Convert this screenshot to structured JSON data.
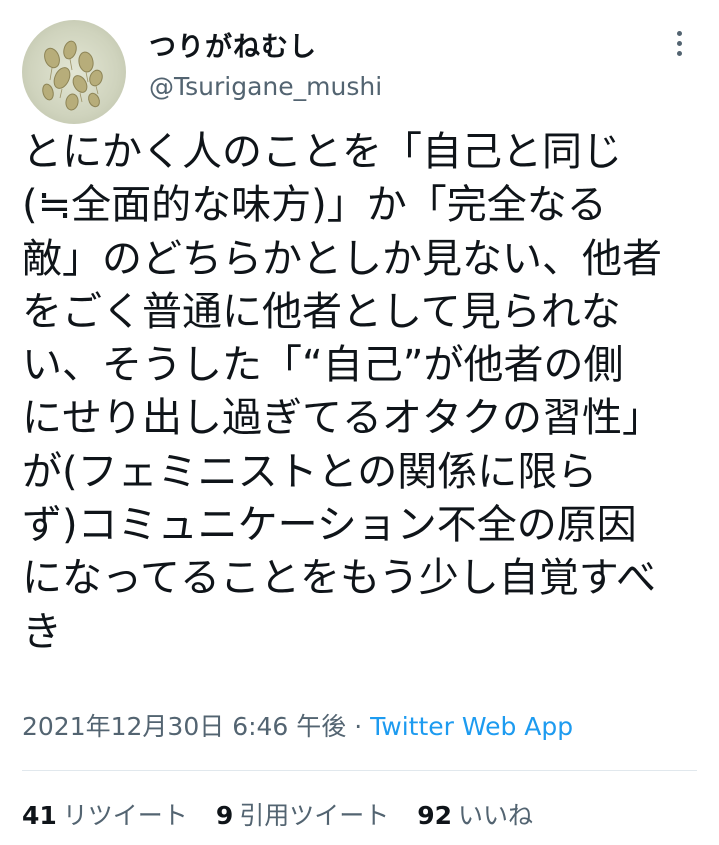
{
  "author": {
    "display_name": "つりがねむし",
    "handle": "@Tsurigane_mushi"
  },
  "tweet": {
    "lines": [
      "とにかく人のことを「自己と同じ",
      "(≒全面的な味方)」か「完全なる",
      "敵」のどちらかとしか見ない、他者",
      "をごく普通に他者として見られな",
      "い、そうした「“自己”が他者の側",
      "にせり出し過ぎてるオタクの習性」",
      "が(フェミニストとの関係に限ら",
      "ず)コミュニケーション不全の原因",
      "になってることをもう少し自覚すべ",
      "き"
    ]
  },
  "meta": {
    "timestamp": "2021年12月30日 6:46 午後",
    "separator": " · ",
    "source": "Twitter Web App"
  },
  "stats": {
    "retweets": {
      "count": "41",
      "label": "リツイート"
    },
    "quotes": {
      "count": "9",
      "label": "引用ツイート"
    },
    "likes": {
      "count": "92",
      "label": "いいね"
    }
  },
  "colors": {
    "text": "#0f1419",
    "secondary": "#536471",
    "link": "#1d9bf0"
  },
  "icons": {
    "more": "more-vertical-icon"
  }
}
